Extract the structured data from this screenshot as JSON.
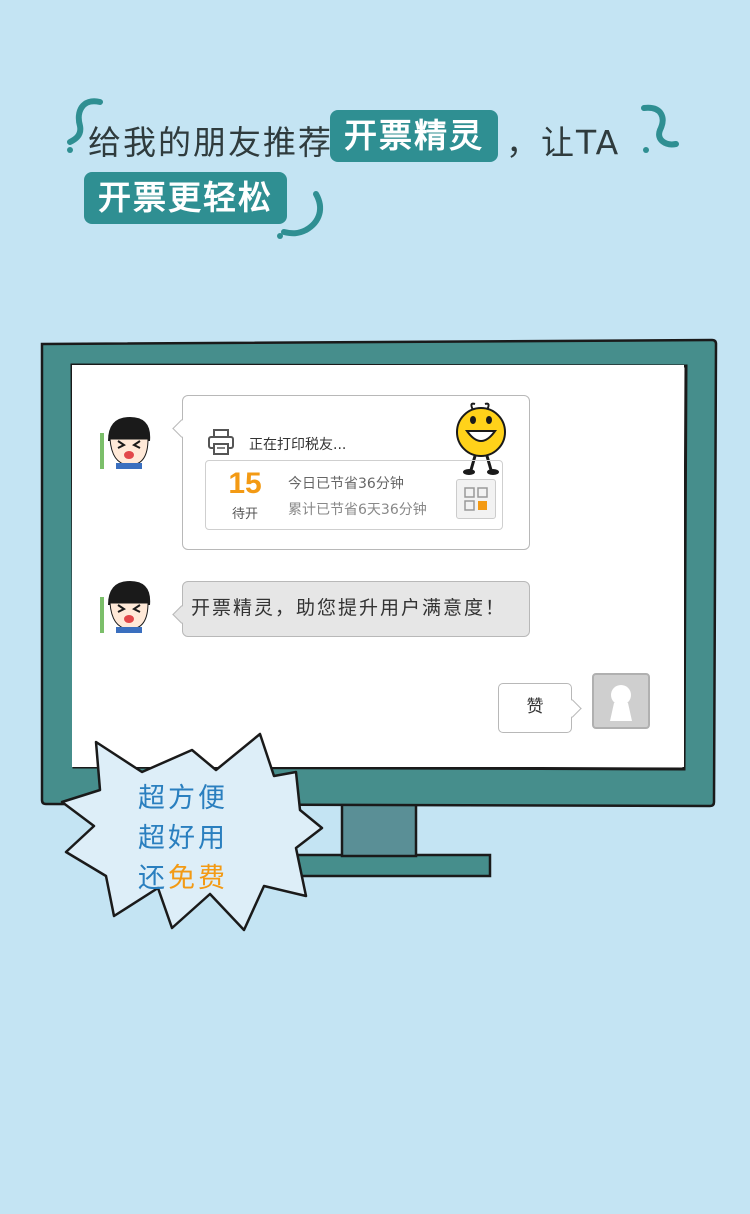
{
  "headline": {
    "part1": "给我的朋友推荐",
    "highlight1": "开票精灵",
    "part2": "，让TA",
    "highlight2": "开票更轻松"
  },
  "chat": {
    "message1": {
      "status": "正在打印税友...",
      "pending_count": "15",
      "pending_label": "待开",
      "today_saved": "今日已节省36分钟",
      "total_saved": "累计已节省6天36分钟"
    },
    "message2": {
      "text": "开票精灵，助您提升用户满意度！"
    },
    "reply": {
      "text": "赞"
    }
  },
  "burst": {
    "line1": "超方便",
    "line2": "超好用",
    "line3_prefix": "还",
    "line3_highlight": "免费"
  },
  "colors": {
    "background": "#c4e4f3",
    "monitor_frame": "#468e8c",
    "highlight": "#2f8f92",
    "accent_orange": "#f39a14",
    "burst_text": "#2a7fbf"
  }
}
